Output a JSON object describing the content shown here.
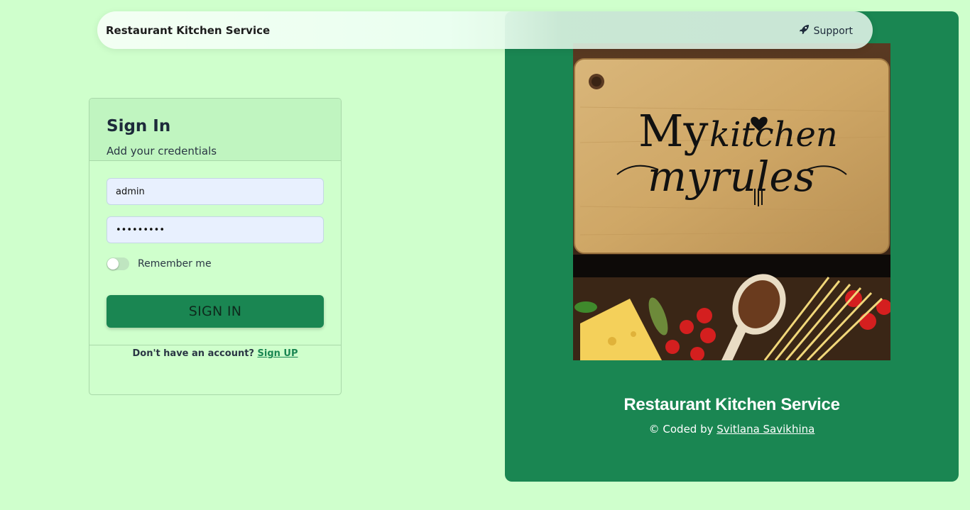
{
  "navbar": {
    "brand": "Restaurant Kitchen Service",
    "support_label": "Support",
    "support_icon": "rocket-icon"
  },
  "signin": {
    "title": "Sign In",
    "subtitle": "Add your credentials",
    "username_value": "admin",
    "password_value": "•••••••••",
    "remember_label": "Remember me",
    "remember_checked": false,
    "button_label": "SIGN IN",
    "no_account_text": "Don't have an account?",
    "signup_link": "Sign UP"
  },
  "brand_panel": {
    "image_text_line1_a": "My",
    "image_text_line1_b": "kitchen",
    "image_text_line2": "myrules",
    "title": "Restaurant Kitchen Service",
    "credit_prefix": "© Coded by",
    "credit_author": "Svitlana Savikhina"
  },
  "colors": {
    "page_bg": "#cfffcc",
    "accent_green": "#1a8652",
    "input_bg": "#e8f0fe"
  }
}
